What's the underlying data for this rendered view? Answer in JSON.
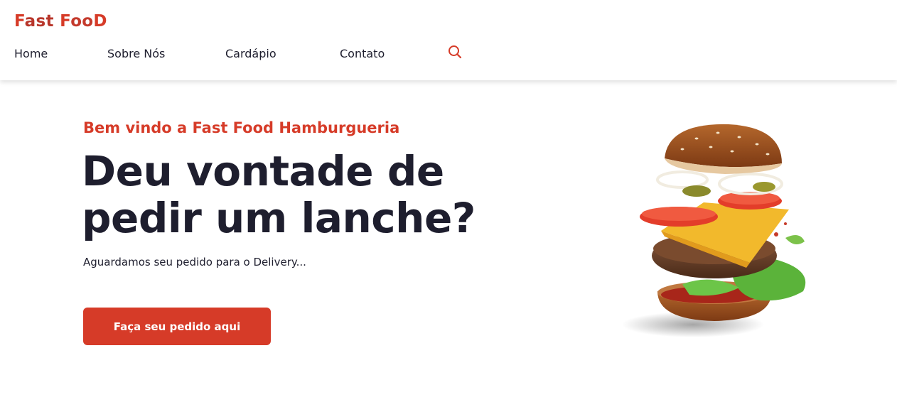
{
  "logo": {
    "p1": "F",
    "p2": "ast ",
    "p3": "F",
    "p4": "oo",
    "p5": "D"
  },
  "nav": {
    "items": [
      "Home",
      "Sobre Nós",
      "Cardápio",
      "Contato"
    ]
  },
  "hero": {
    "welcome": "Bem vindo a Fast Food Hamburgueria",
    "title_line1": "Deu vontade de",
    "title_line2": "pedir um lanche?",
    "subtitle": "Aguardamos seu pedido para o Delivery...",
    "cta_label": "Faça seu pedido aqui"
  },
  "colors": {
    "accent": "#d63b28",
    "text": "#1e1e2e"
  },
  "icons": {
    "search": "search-icon",
    "hero_image": "burger-image"
  }
}
